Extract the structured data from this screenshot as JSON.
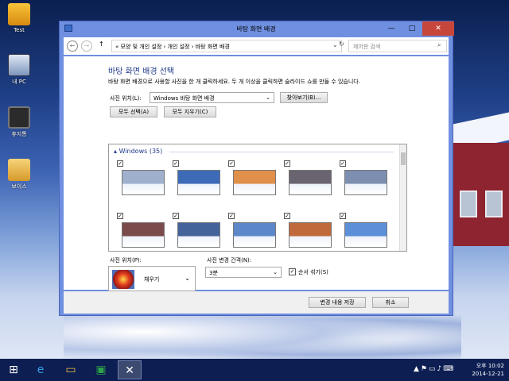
{
  "desktop": {
    "icons": [
      {
        "label": "Test"
      },
      {
        "label": "내 PC"
      },
      {
        "label": "휴지통"
      },
      {
        "label": "보이스"
      }
    ]
  },
  "window": {
    "title": "바탕 화면 배경",
    "minimize": "—",
    "maximize": "□",
    "close": "✕"
  },
  "address": {
    "crumbs": "« 모양 및 개인 설정 › 개인 설정 › 바탕 화면 배경",
    "search_placeholder": "제어판 검색"
  },
  "content": {
    "heading": "바탕 화면 배경 선택",
    "subtext": "바탕 화면 배경으로 사용할 사진을 한 개 클릭하세요. 두 개 이상을 클릭하면 슬라이드 쇼를 만들 수 있습니다.",
    "location_label": "사진 위치(L):",
    "location_value": "Windows 바탕 화면 배경",
    "browse": "찾아보기(B)...",
    "select_all": "모두 선택(A)",
    "clear_all": "모두 지우기(C)",
    "group": "Windows (35)",
    "thumbnails": [
      {
        "checked": "✓",
        "color": "#9fb0cc"
      },
      {
        "checked": "✓",
        "color": "#3d6bb8"
      },
      {
        "checked": "✓",
        "color": "#e0904a"
      },
      {
        "checked": "✓",
        "color": "#6a6470"
      },
      {
        "checked": "✓",
        "color": "#7d8fb0"
      },
      {
        "checked": "✓",
        "color": "#7a4b4a"
      },
      {
        "checked": "✓",
        "color": "#44639a"
      },
      {
        "checked": "✓",
        "color": "#5c87c8"
      },
      {
        "checked": "✓",
        "color": "#c0693a"
      },
      {
        "checked": "✓",
        "color": "#5b8fd8"
      }
    ],
    "position_label": "사진 위치(P):",
    "position_value": "채우기",
    "interval_label": "사진 변경 간격(N):",
    "interval_value": "3분",
    "shuffle_label": "순서 섞기(S)",
    "shuffle_checked": "✓"
  },
  "footer": {
    "save": "변경 내용 저장",
    "cancel": "취소"
  },
  "taskbar": {
    "time": "오후 10:02",
    "date": "2014-12-21"
  }
}
